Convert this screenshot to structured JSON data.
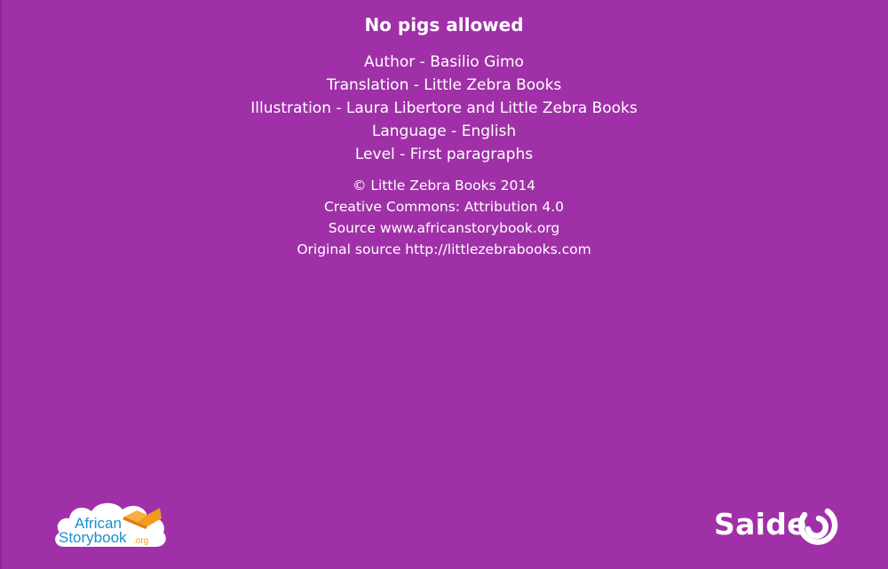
{
  "title": "No pigs allowed",
  "credits": [
    "Author - Basilio Gimo",
    "Translation - Little Zebra Books",
    "Illustration - Laura Libertore and Little Zebra Books",
    "Language - English",
    "Level - First paragraphs"
  ],
  "license": [
    "© Little Zebra Books 2014",
    "Creative Commons: Attribution 4.0",
    "Source www.africanstorybook.org",
    "Original source http://littlezebrabooks.com"
  ],
  "logos": {
    "asb_line1": "African",
    "asb_line2": "Storybook",
    "asb_suffix": ".org",
    "saide": "Saide"
  },
  "colors": {
    "background": "#a030a8",
    "text": "#ffffff",
    "asb_blue": "#1a8fcf",
    "asb_orange": "#f39a1e"
  }
}
